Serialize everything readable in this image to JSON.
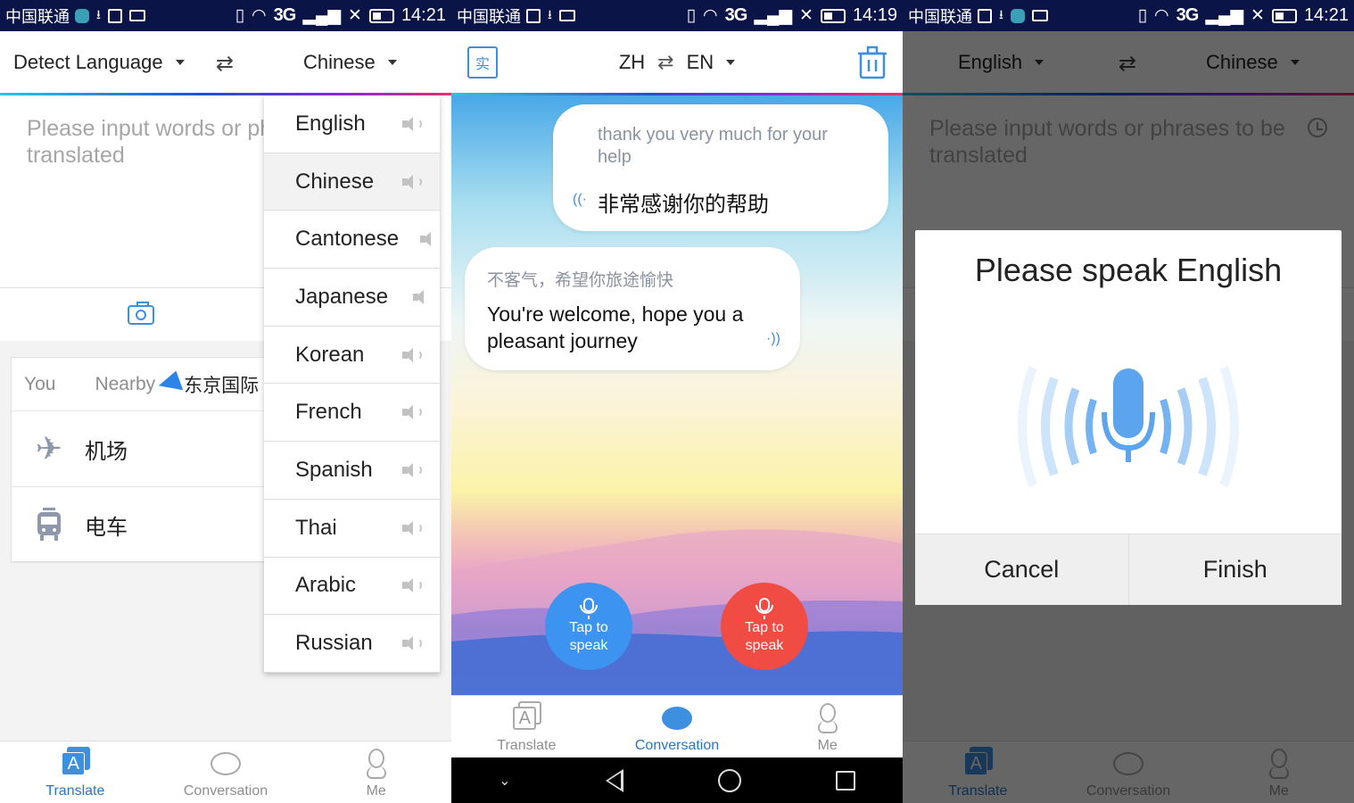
{
  "status_bars": [
    {
      "carrier": "中国联通",
      "time": "14:21",
      "network": "3G"
    },
    {
      "carrier": "中国联通",
      "time": "14:19",
      "network": "3G"
    },
    {
      "carrier": "中国联通",
      "time": "14:21",
      "network": "3G"
    }
  ],
  "screen1": {
    "source_lang": "Detect Language",
    "target_lang": "Chinese",
    "input_placeholder": "Please input words or phrases to be translated",
    "nearby": {
      "you_label": "You",
      "nearby_label": "Nearby",
      "location": "东京国际",
      "items": [
        {
          "icon": "airplane-icon",
          "label": "机场"
        },
        {
          "icon": "tram-icon",
          "label": "电车"
        }
      ]
    },
    "language_menu": {
      "selected": "Chinese",
      "options": [
        "English",
        "Chinese",
        "Cantonese",
        "Japanese",
        "Korean",
        "French",
        "Spanish",
        "Thai",
        "Arabic",
        "Russian"
      ]
    }
  },
  "screen2": {
    "lang_from": "ZH",
    "lang_to": "EN",
    "book_icon_char": "实",
    "messages": [
      {
        "source": "thank you very much for your help",
        "translation": "非常感谢你的帮助",
        "side": "right"
      },
      {
        "source": "不客气，希望你旅途愉快",
        "translation": "You're welcome, hope you a pleasant journey",
        "side": "left"
      }
    ],
    "speak_buttons": [
      {
        "label": "Tap to speak",
        "color": "#3d94f0"
      },
      {
        "label": "Tap to speak",
        "color": "#f04c44"
      }
    ]
  },
  "screen3": {
    "source_lang": "English",
    "target_lang": "Chinese",
    "input_placeholder": "Please input words or phrases to be translated",
    "dialog": {
      "title": "Please speak English",
      "cancel": "Cancel",
      "finish": "Finish"
    }
  },
  "tabs": {
    "translate": "Translate",
    "conversation": "Conversation",
    "me": "Me"
  },
  "colors": {
    "accent": "#2a76c6",
    "icon_blue": "#3d8fe0",
    "status_bar": "#0b1447"
  }
}
